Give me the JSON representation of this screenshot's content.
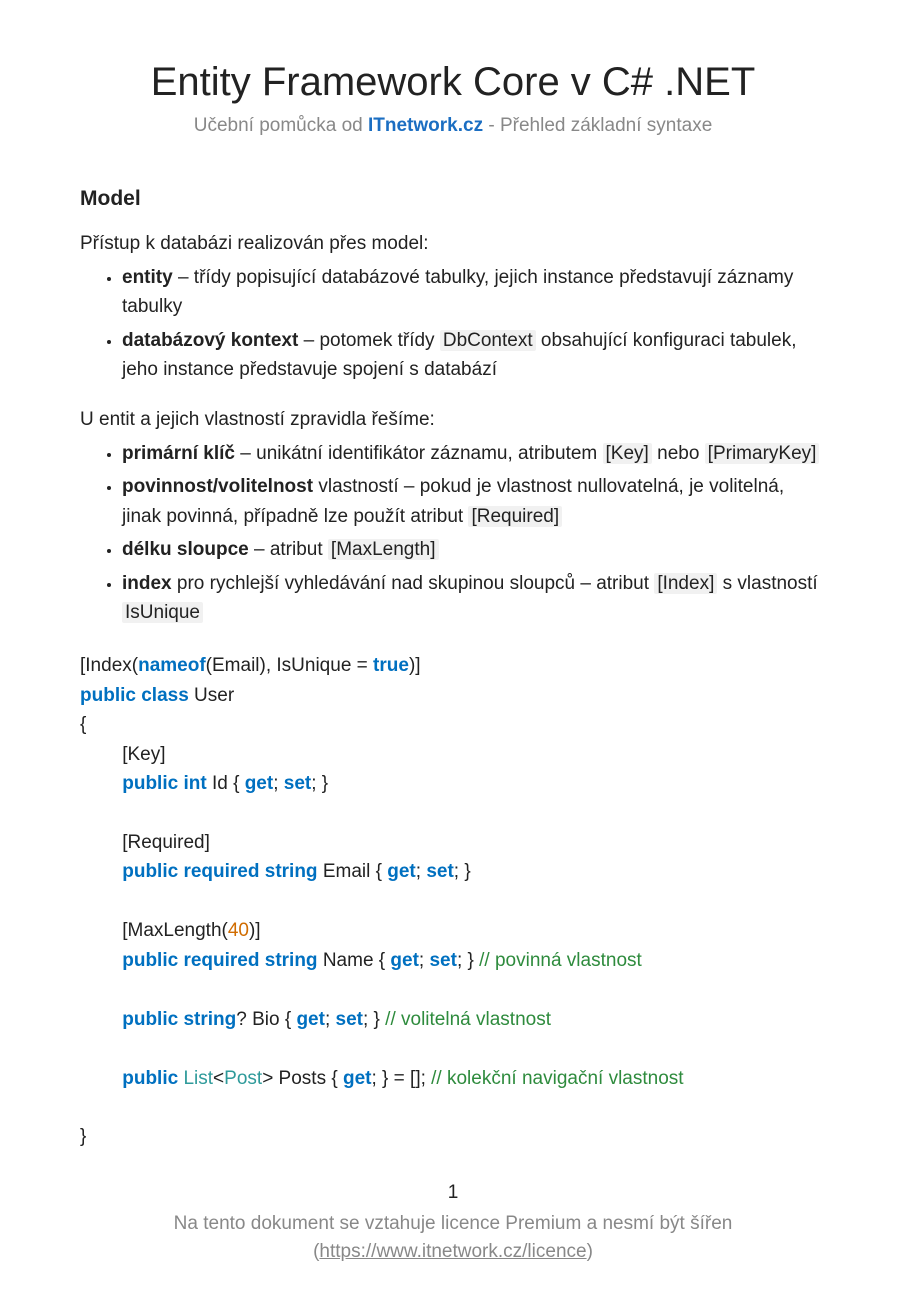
{
  "title": "Entity Framework Core v C# .NET",
  "subtitle_pre": "Učební pomůcka od ",
  "subtitle_link": "ITnetwork.cz",
  "subtitle_post": " - Přehled základní syntaxe",
  "section_model": "Model",
  "p1": "Přístup k databázi realizován přes model:",
  "li1_a": "entity",
  "li1_b": " – třídy popisující databázové tabulky, jejich instance představují záznamy tabulky",
  "li2_a": "databázový kontext",
  "li2_b": " – potomek třídy ",
  "li2_code": "DbContext",
  "li2_c": " obsahující konfiguraci tabulek, jeho instance představuje spojení s databází",
  "p2": "U entit a jejich vlastností zpravidla řešíme:",
  "li3_a": "primární klíč",
  "li3_b": " – unikátní identifikátor záznamu, atributem ",
  "li3_c1": "[Key]",
  "li3_d": " nebo ",
  "li3_c2": "[PrimaryKey]",
  "li4_a": "povinnost/volitelnost",
  "li4_b": " vlastností – pokud je vlastnost nullovatelná, je volitelná, jinak povinná, případně lze použít atribut ",
  "li4_c": "[Required]",
  "li5_a": "délku sloupce",
  "li5_b": " – atribut ",
  "li5_c": "[MaxLength]",
  "li6_a": "index",
  "li6_b": " pro rychlejší vyhledávání nad skupinou sloupců – atribut ",
  "li6_c1": "[Index]",
  "li6_d": " s vlastností ",
  "li6_c2": "IsUnique",
  "code": {
    "l1a": "[Index(",
    "l1b": "nameof",
    "l1c": "(Email), IsUnique = ",
    "l1d": "true",
    "l1e": ")]",
    "l2a": "public class",
    "l2b": " User",
    "l3": "{",
    "l4": "        [Key]",
    "l5a": "        ",
    "l5b": "public int",
    "l5c": " Id { ",
    "l5d": "get",
    "l5e": "; ",
    "l5f": "set",
    "l5g": "; }",
    "l6": "        [Required]",
    "l7a": "        ",
    "l7b": "public required string",
    "l7c": " Email { ",
    "l7d": "get",
    "l7e": "; ",
    "l7f": "set",
    "l7g": "; }",
    "l8a": "        [MaxLength(",
    "l8b": "40",
    "l8c": ")]",
    "l9a": "        ",
    "l9b": "public required string",
    "l9c": " Name { ",
    "l9d": "get",
    "l9e": "; ",
    "l9f": "set",
    "l9g": "; } ",
    "l9h": "// povinná vlastnost",
    "l10a": "        ",
    "l10b": "public string",
    "l10c": "? Bio { ",
    "l10d": "get",
    "l10e": "; ",
    "l10f": "set",
    "l10g": "; } ",
    "l10h": "// volitelná vlastnost",
    "l11a": "        ",
    "l11b": "public",
    "l11c": " ",
    "l11d": "List",
    "l11e": "<",
    "l11f": "Post",
    "l11g": "> Posts { ",
    "l11h": "get",
    "l11i": "; } = []; ",
    "l11j": "// kolekční navigační vlastnost",
    "l12": "}"
  },
  "page_num": "1",
  "footer1": "Na tento dokument se vztahuje licence Premium a nesmí být šířen",
  "footer2a": "(",
  "footer2b": "https://www.itnetwork.cz/licence",
  "footer2c": ")"
}
